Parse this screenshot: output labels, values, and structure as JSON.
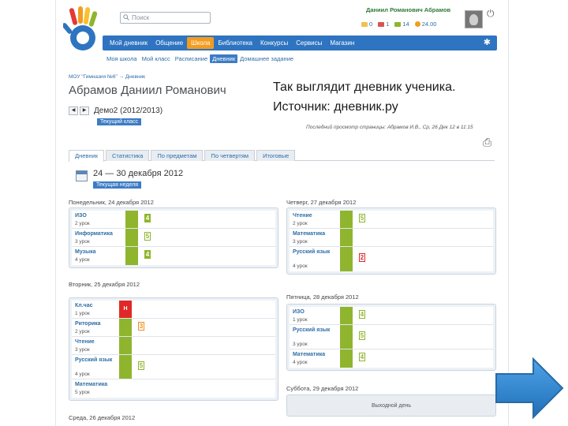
{
  "header": {
    "search_placeholder": "Поиск",
    "username": "Даниил Романович Абрамов",
    "counters": [
      {
        "value": "0",
        "color": "#f2c14e"
      },
      {
        "value": "1",
        "color": "#d9534f"
      },
      {
        "value": "14",
        "color": "#8fb52e"
      },
      {
        "value": "24.00",
        "color": "#f39c1f"
      }
    ]
  },
  "mainnav": {
    "items": [
      "Мой дневник",
      "Общение",
      "Школа",
      "Библиотека",
      "Конкурсы",
      "Сервисы",
      "Магазин"
    ],
    "active_index": 2
  },
  "subnav": {
    "items": [
      "Моя школа",
      "Мой класс",
      "Расписание",
      "Дневник",
      "Домашнее задание"
    ],
    "active_index": 3
  },
  "breadcrumb": "МОУ \"Гимназия №6\" → Дневник",
  "student_name": "Абрамов Даниил Романович",
  "diary_name": "Демо2 (2012/2013)",
  "current_class_label": "Текущий класс",
  "last_view": "Последний просмотр страницы: Абрамов И.В., Ср, 26 Дек 12 в 11:15",
  "tabs": [
    "Дневник",
    "Статистика",
    "По предметам",
    "По четвертям",
    "Итоговые"
  ],
  "week_range": "24 — 30 декабря 2012",
  "current_week_label": "Текущая неделя",
  "days": {
    "mon": {
      "title": "Понедельник, 24 декабря 2012",
      "lessons": [
        {
          "subject": "ИЗО",
          "lesson": "2 урок",
          "grade": "4"
        },
        {
          "subject": "Информатика",
          "lesson": "3 урок",
          "grade": "5"
        },
        {
          "subject": "Музыка",
          "lesson": "4 урок",
          "grade": "4"
        }
      ]
    },
    "tue": {
      "title": "Вторник, 25 декабря 2012",
      "lessons": [
        {
          "subject": "Кл.час",
          "lesson": "1 урок",
          "mark": "Н"
        },
        {
          "subject": "Риторика",
          "lesson": "2 урок",
          "grade": "3"
        },
        {
          "subject": "Чтение",
          "lesson": "3 урок"
        },
        {
          "subject": "Русский язык",
          "lesson": "4 урок",
          "grade": "5"
        },
        {
          "subject": "Математика",
          "lesson": "5 урок"
        }
      ]
    },
    "wed": {
      "title": "Среда, 26 декабря 2012"
    },
    "thu": {
      "title": "Четверг, 27 декабря 2012",
      "lessons": [
        {
          "subject": "Чтение",
          "lesson": "2 урок",
          "grade": "5"
        },
        {
          "subject": "Математика",
          "lesson": "3 урок"
        },
        {
          "subject": "Русский язык",
          "lesson": "4 урок",
          "grade": "2"
        }
      ]
    },
    "fri": {
      "title": "Пятница, 28 декабря 2012",
      "lessons": [
        {
          "subject": "ИЗО",
          "lesson": "1 урок",
          "grade": "4"
        },
        {
          "subject": "Русский язык",
          "lesson": "3 урок",
          "grade": "5"
        },
        {
          "subject": "Математика",
          "lesson": "4 урок",
          "grade": "4"
        }
      ]
    },
    "sat": {
      "title": "Суббота, 29 декабря 2012",
      "holiday": "Выходной день"
    }
  },
  "caption": {
    "line1": "Так выглядит дневник ученика.",
    "line2": "Источник: дневник.ру"
  }
}
